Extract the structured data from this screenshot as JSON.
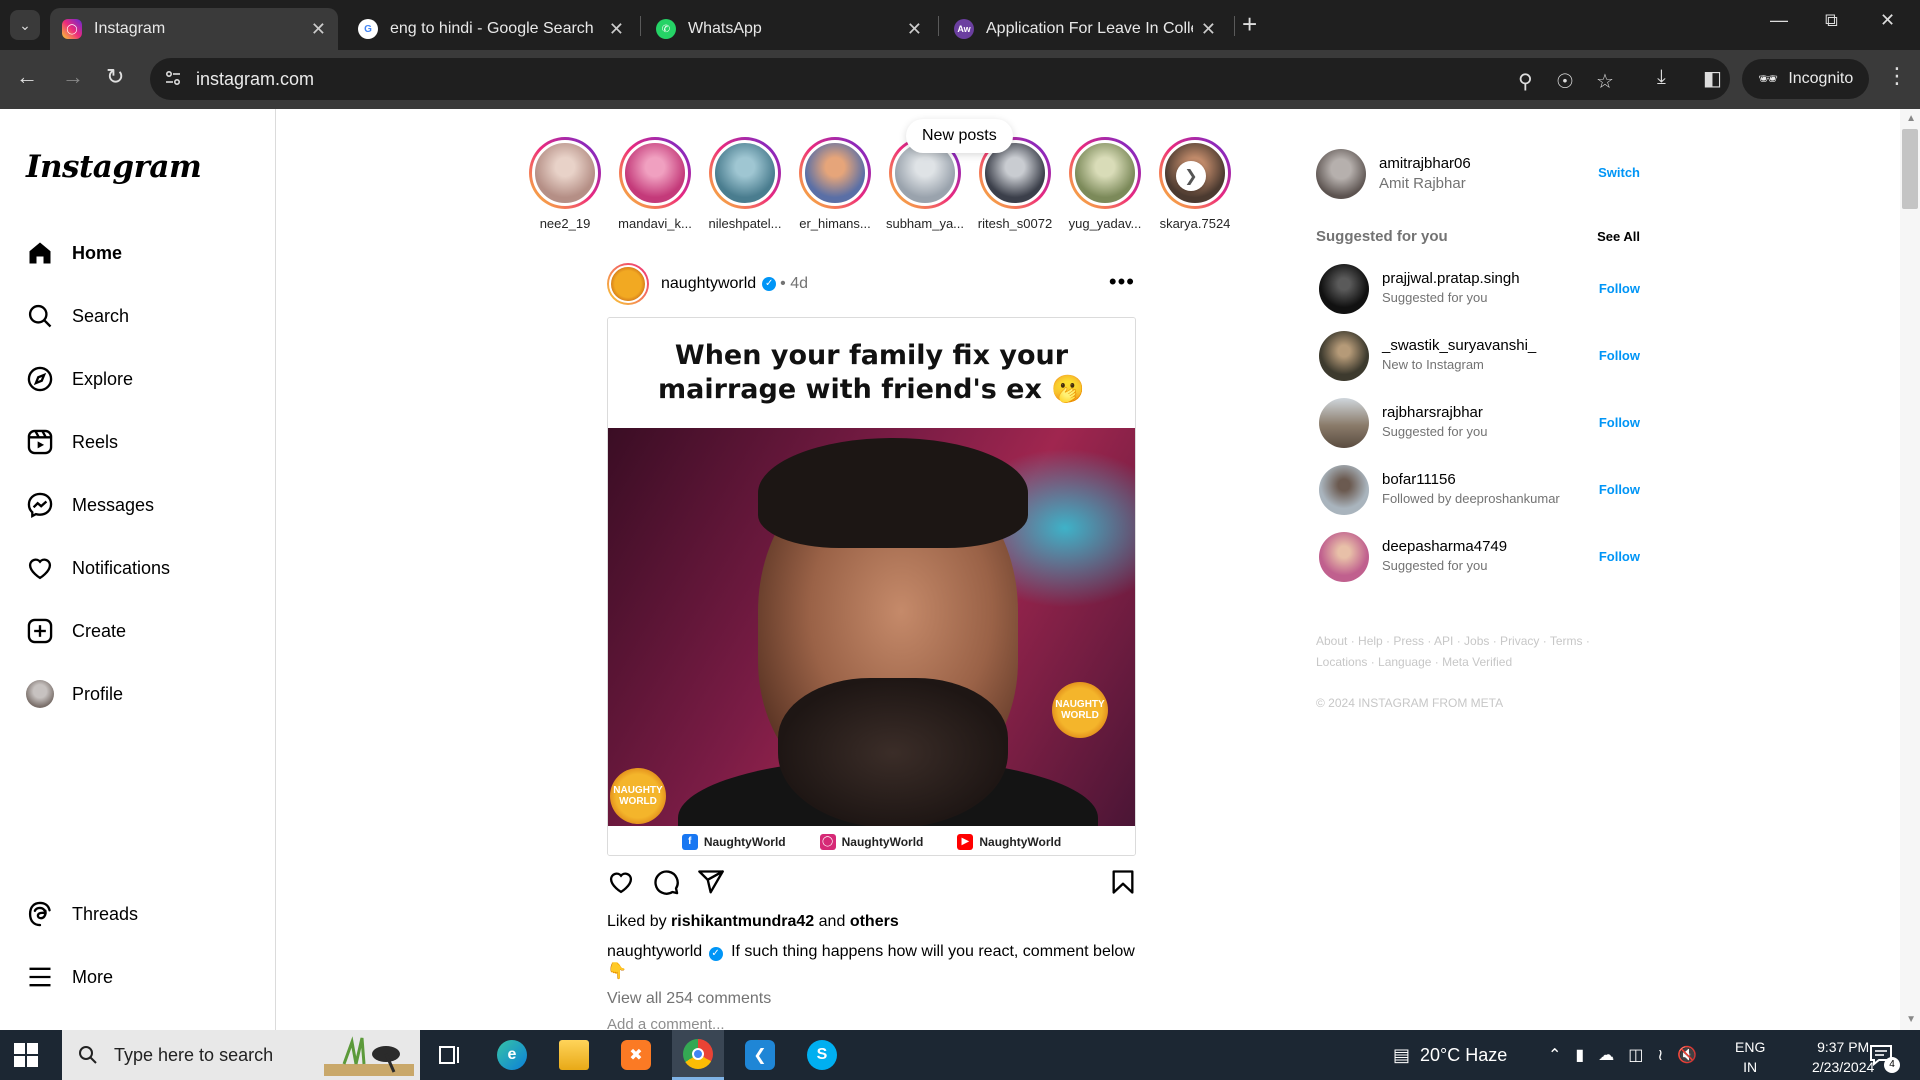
{
  "browser": {
    "tabs": [
      {
        "title": "Instagram",
        "favicon": "instagram-icon",
        "active": true
      },
      {
        "title": "eng to hindi - Google Search",
        "favicon": "google-icon",
        "active": false
      },
      {
        "title": "WhatsApp",
        "favicon": "whatsapp-icon",
        "active": false
      },
      {
        "title": "Application For Leave In College",
        "favicon": "aw-icon",
        "active": false
      }
    ],
    "url": "instagram.com",
    "incognito_label": "Incognito"
  },
  "instagram": {
    "logo": "Instagram",
    "nav": [
      {
        "label": "Home",
        "icon": "home-icon"
      },
      {
        "label": "Search",
        "icon": "search-icon"
      },
      {
        "label": "Explore",
        "icon": "compass-icon"
      },
      {
        "label": "Reels",
        "icon": "reels-icon"
      },
      {
        "label": "Messages",
        "icon": "messenger-icon"
      },
      {
        "label": "Notifications",
        "icon": "heart-icon"
      },
      {
        "label": "Create",
        "icon": "plus-square-icon"
      },
      {
        "label": "Profile",
        "icon": "avatar"
      }
    ],
    "nav_bottom": [
      {
        "label": "Threads",
        "icon": "threads-icon"
      },
      {
        "label": "More",
        "icon": "menu-icon"
      }
    ],
    "new_posts_label": "New posts",
    "stories": [
      {
        "name": "nee2_19",
        "color": "#b58f86"
      },
      {
        "name": "mandavi_k...",
        "color": "#c43a7a"
      },
      {
        "name": "nileshpatel...",
        "color": "#4a7d8f"
      },
      {
        "name": "er_himans...",
        "color": "#5a6fa6"
      },
      {
        "name": "subham_ya...",
        "color": "#9aa3ad"
      },
      {
        "name": "ritesh_s0072",
        "color": "#3b3f4a"
      },
      {
        "name": "yug_yadav...",
        "color": "#7c8a5a"
      },
      {
        "name": "skarya.7524",
        "color": "#4b3a30"
      }
    ],
    "post": {
      "username": "naughtyworld",
      "age": "4d",
      "meme_text": "When your family fix your mairrage with friend's ex 🫢",
      "watermark": "NAUGHTY WORLD",
      "footer_handles": [
        {
          "platform": "facebook-icon",
          "handle": "NaughtyWorld",
          "color": "#1877f2"
        },
        {
          "platform": "instagram-icon",
          "handle": "NaughtyWorld",
          "color": "#d62976"
        },
        {
          "platform": "youtube-icon",
          "handle": "NaughtyWorld",
          "color": "#ff0000"
        }
      ],
      "liked_by_prefix": "Liked by",
      "liked_by_user": "rishikantmundra42",
      "liked_by_and": "and",
      "liked_by_others": "others",
      "caption": "If such thing happens how will you react, comment below 👇",
      "view_comments": "View all 254 comments",
      "add_comment_placeholder": "Add a comment..."
    },
    "me": {
      "username": "amitrajbhar06",
      "full_name": "Amit Rajbhar",
      "switch_label": "Switch"
    },
    "suggested_title": "Suggested for you",
    "see_all": "See All",
    "suggestions": [
      {
        "username": "prajjwal.pratap.singh",
        "sub": "Suggested for you",
        "follow": "Follow",
        "color": "#111111"
      },
      {
        "username": "_swastik_suryavanshi_",
        "sub": "New to Instagram",
        "follow": "Follow",
        "color": "#3d3a2e"
      },
      {
        "username": "rajbharsrajbhar",
        "sub": "Suggested for you",
        "follow": "Follow",
        "color": "#8a7b6a"
      },
      {
        "username": "bofar11156",
        "sub": "Followed by deeproshankumar",
        "follow": "Follow",
        "color": "#a9b4bd"
      },
      {
        "username": "deepasharma4749",
        "sub": "Suggested for you",
        "follow": "Follow",
        "color": "#c0608e"
      }
    ],
    "footer_line1": "About · Help · Press · API · Jobs · Privacy · Terms ·",
    "footer_line2": "Locations · Language · Meta Verified",
    "copyright": "© 2024 INSTAGRAM FROM META"
  },
  "taskbar": {
    "search_placeholder": "Type here to search",
    "apps": [
      "task-view-icon",
      "edge-icon",
      "file-explorer-icon",
      "xampp-icon",
      "chrome-icon",
      "vscode-icon",
      "skype-icon"
    ],
    "weather": "20°C  Haze",
    "lang_line1": "ENG",
    "lang_line2": "IN",
    "time": "9:37 PM",
    "date": "2/23/2024",
    "notification_count": "4"
  }
}
